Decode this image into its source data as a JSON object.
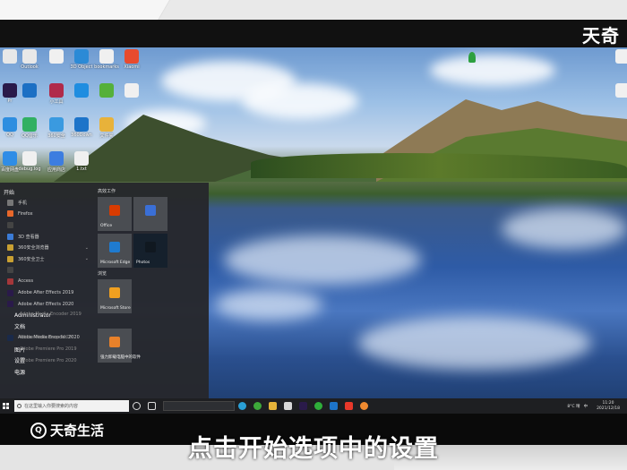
{
  "desk": {
    "card_text": ""
  },
  "watermark_top": "天奇",
  "desktop_icons": [
    {
      "label": "",
      "color": "#e8e8e8"
    },
    {
      "label": "Outlook",
      "color": "#e8e8e8"
    },
    {
      "label": "",
      "color": "#f0f0f0"
    },
    {
      "label": "3D Object",
      "color": "#2b8ad6"
    },
    {
      "label": "bookmarks",
      "color": "#f0f0f0"
    },
    {
      "label": "Xiaomi",
      "color": "#e84b2e"
    },
    {
      "label": "Pr",
      "color": "#2a1a4a"
    },
    {
      "label": "",
      "color": "#1b6fc4"
    },
    {
      "label": "小工具",
      "color": "#b02a4a"
    },
    {
      "label": "",
      "color": "#1f8de0"
    },
    {
      "label": "",
      "color": "#55b03a"
    },
    {
      "label": "",
      "color": "#f0f0f0"
    },
    {
      "label": "QQ",
      "color": "#2e8ee0"
    },
    {
      "label": "QQ音乐",
      "color": "#31b062"
    },
    {
      "label": "360安全",
      "color": "#3a9ae0"
    },
    {
      "label": "360Down",
      "color": "#1d74c9"
    },
    {
      "label": "文件夹",
      "color": "#e8b23a"
    },
    {
      "label": "百度网盘",
      "color": "#2f8de6"
    },
    {
      "label": "debug.log",
      "color": "#f0f0f0"
    },
    {
      "label": "应用商店",
      "color": "#3d7de0"
    },
    {
      "label": "1.txt",
      "color": "#f0f0f0"
    }
  ],
  "start_menu": {
    "header": "开始",
    "apps": [
      {
        "label": "手机",
        "color": "#777",
        "side": false
      },
      {
        "label": "Firefox",
        "color": "#e8672a",
        "side": false
      },
      {
        "label": "",
        "color": "#444",
        "side": false
      },
      {
        "label": "3D 查看器",
        "color": "#3b7bd6",
        "side": false
      },
      {
        "label": "360安全浏览器",
        "color": "#c9a032",
        "side": false,
        "chev": true
      },
      {
        "label": "360安全卫士",
        "color": "#c9a032",
        "side": false,
        "chev": true
      },
      {
        "label": "",
        "color": "#444",
        "side": false
      },
      {
        "label": "Access",
        "color": "#a4373a",
        "side": false
      },
      {
        "label": "Adobe After Effects 2019",
        "color": "#2a1a4a",
        "side": false
      },
      {
        "label": "Adobe After Effects 2020",
        "color": "#2a1a4a",
        "side": false
      },
      {
        "label": "Administrator",
        "color": "transparent",
        "side": true
      },
      {
        "label": "文档",
        "color": "transparent",
        "side": true
      },
      {
        "label": "Adobe Media Encoder 2020",
        "color": "#1a2a4a",
        "side": false
      },
      {
        "label": "图片",
        "color": "transparent",
        "side": true
      },
      {
        "label": "设置",
        "color": "transparent",
        "side": true
      },
      {
        "label": "电源",
        "color": "transparent",
        "side": true
      }
    ],
    "apps_overlay": [
      "Adobe Media Encoder 2019",
      "Adobe Photoshop 2020",
      "Adobe Premiere Pro 2019",
      "Adobe Premiere Pro 2020"
    ],
    "tiles_header_1": "高效工作",
    "tiles_header_2": "浏览",
    "tiles": [
      {
        "label": "Office",
        "color": "#d83b01"
      },
      {
        "label": "",
        "color": "#3a6fd6"
      },
      {
        "label": "Microsoft Edge",
        "color": "#1f7bd0"
      },
      {
        "label": "Photos",
        "color": "#101820"
      },
      {
        "label": "Microsoft Store",
        "color": "#f0a020"
      },
      {
        "label": "强力卸载电脑中的软件",
        "color": "#e8812a"
      }
    ]
  },
  "taskbar": {
    "search_placeholder": "在这里输入你要搜索的内容",
    "address": "",
    "temperature": "8°C 晴",
    "lang": "中",
    "time": "11:20",
    "date": "2021/12/18"
  },
  "bottom": {
    "brand": "天奇生活",
    "logo_glyph": "Q",
    "caption": "点击开始选项中的设置"
  }
}
